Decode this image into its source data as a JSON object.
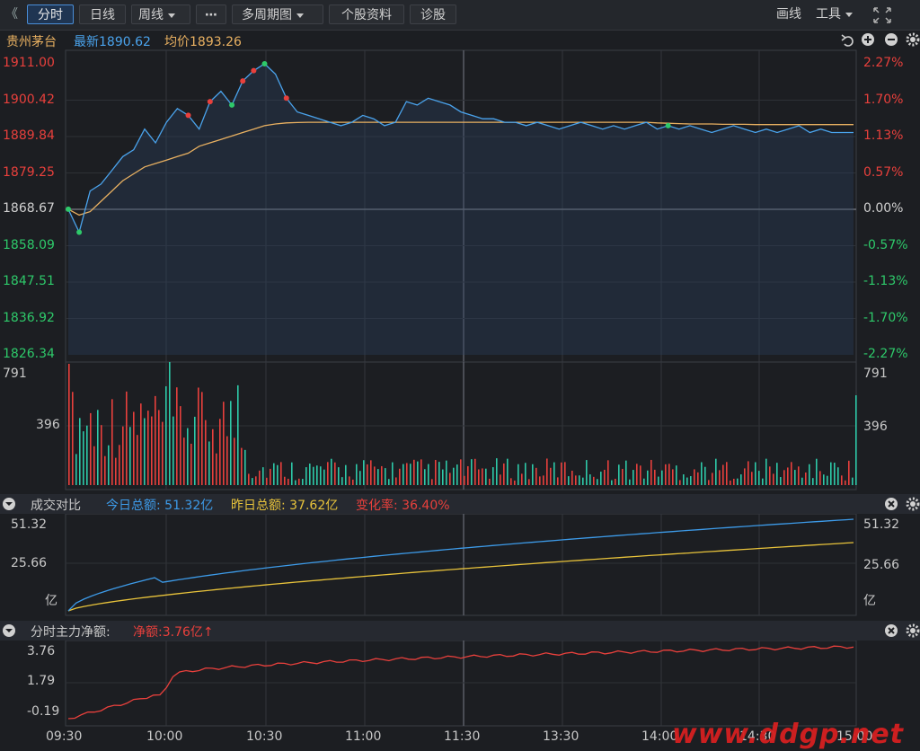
{
  "toolbar": {
    "back_glyph": "《",
    "tabs": [
      "分时",
      "日线",
      "周线",
      "⋯",
      "多周期图",
      "个股资料",
      "诊股"
    ],
    "right_items": [
      "画线",
      "工具"
    ],
    "fullscreen_icon": "expand-icon"
  },
  "stock": {
    "name": "贵州茅台",
    "latest_label": "最新",
    "latest_value": "1890.62",
    "avg_label": "均价",
    "avg_value": "1893.26"
  },
  "price_axis": {
    "left": [
      "1911.00",
      "1900.42",
      "1889.84",
      "1879.25",
      "1868.67",
      "1858.09",
      "1847.51",
      "1836.92",
      "1826.34"
    ],
    "right": [
      "2.27%",
      "1.70%",
      "1.13%",
      "0.57%",
      "0.00%",
      "-0.57%",
      "-1.13%",
      "-1.70%",
      "-2.27%"
    ]
  },
  "volume_axis": {
    "left": [
      "791",
      "396"
    ],
    "right": [
      "791",
      "396"
    ]
  },
  "turnover_panel": {
    "title": "成交对比",
    "today_label": "今日总额:",
    "today_value": "51.32亿",
    "yesterday_label": "昨日总额:",
    "yesterday_value": "37.62亿",
    "change_label": "变化率:",
    "change_value": "36.40%",
    "axis_left": [
      "51.32",
      "25.66",
      "亿"
    ],
    "axis_right": [
      "51.32",
      "25.66",
      "亿"
    ]
  },
  "netflow_panel": {
    "title": "分时主力净额:",
    "net_label": "净额:",
    "net_value": "3.76亿",
    "arrow": "↑",
    "axis_left": [
      "3.76",
      "1.79",
      "-0.19"
    ]
  },
  "time_axis": [
    "09:30",
    "10:00",
    "10:30",
    "11:00",
    "11:30",
    "13:30",
    "14:00",
    "14:30",
    "15:00"
  ],
  "watermark": "www.ddgp.net",
  "colors": {
    "price_line": "#4aa3ec",
    "avg_line": "#e8b061",
    "up": "#e8403c",
    "down": "#2ec9a8",
    "today_turnover": "#3d9be9",
    "yesterday_turnover": "#e8c33b",
    "netflow": "#e8403c"
  },
  "chart_data": {
    "type": "line",
    "prev_close": 1868.67,
    "ylim": [
      1826.34,
      1911.0
    ],
    "price": [
      1868.7,
      1862,
      1874,
      1876,
      1880,
      1884,
      1886,
      1892,
      1888,
      1894,
      1898,
      1896,
      1892,
      1900,
      1903,
      1899,
      1906,
      1909,
      1911,
      1908,
      1901,
      1897,
      1896,
      1895,
      1894,
      1893,
      1894,
      1896,
      1895,
      1893,
      1894,
      1900,
      1899,
      1901,
      1900,
      1899,
      1897,
      1896,
      1895,
      1895,
      1894,
      1894,
      1893,
      1894,
      1893,
      1892,
      1893,
      1894,
      1893,
      1892,
      1893,
      1892,
      1893,
      1894,
      1892,
      1893,
      1892,
      1893,
      1892,
      1891,
      1892,
      1893,
      1892,
      1891,
      1892,
      1891,
      1892,
      1893,
      1891,
      1892,
      1891,
      1891,
      1891
    ],
    "avg": [
      1868.7,
      1867,
      1868,
      1871,
      1874,
      1877,
      1879,
      1881,
      1882,
      1883,
      1884,
      1885,
      1887,
      1888,
      1889,
      1890,
      1891,
      1892,
      1893,
      1893.5,
      1893.8,
      1893.9,
      1894,
      1894,
      1894,
      1894,
      1894,
      1894,
      1894,
      1894,
      1894,
      1894,
      1894,
      1894,
      1894,
      1894,
      1894,
      1894,
      1894,
      1894,
      1894,
      1894,
      1894,
      1894,
      1894,
      1894,
      1894,
      1894,
      1894,
      1894,
      1894,
      1894,
      1894,
      1894,
      1893.8,
      1893.7,
      1893.6,
      1893.5,
      1893.5,
      1893.5,
      1893.4,
      1893.4,
      1893.4,
      1893.3,
      1893.3,
      1893.3,
      1893.3,
      1893.3,
      1893.3,
      1893.3,
      1893.3,
      1893.3,
      1893.3
    ],
    "volume_max": 791,
    "turnover_today_max": 51.32,
    "turnover_yesterday_max": 37.62,
    "netflow_final": 3.76
  }
}
